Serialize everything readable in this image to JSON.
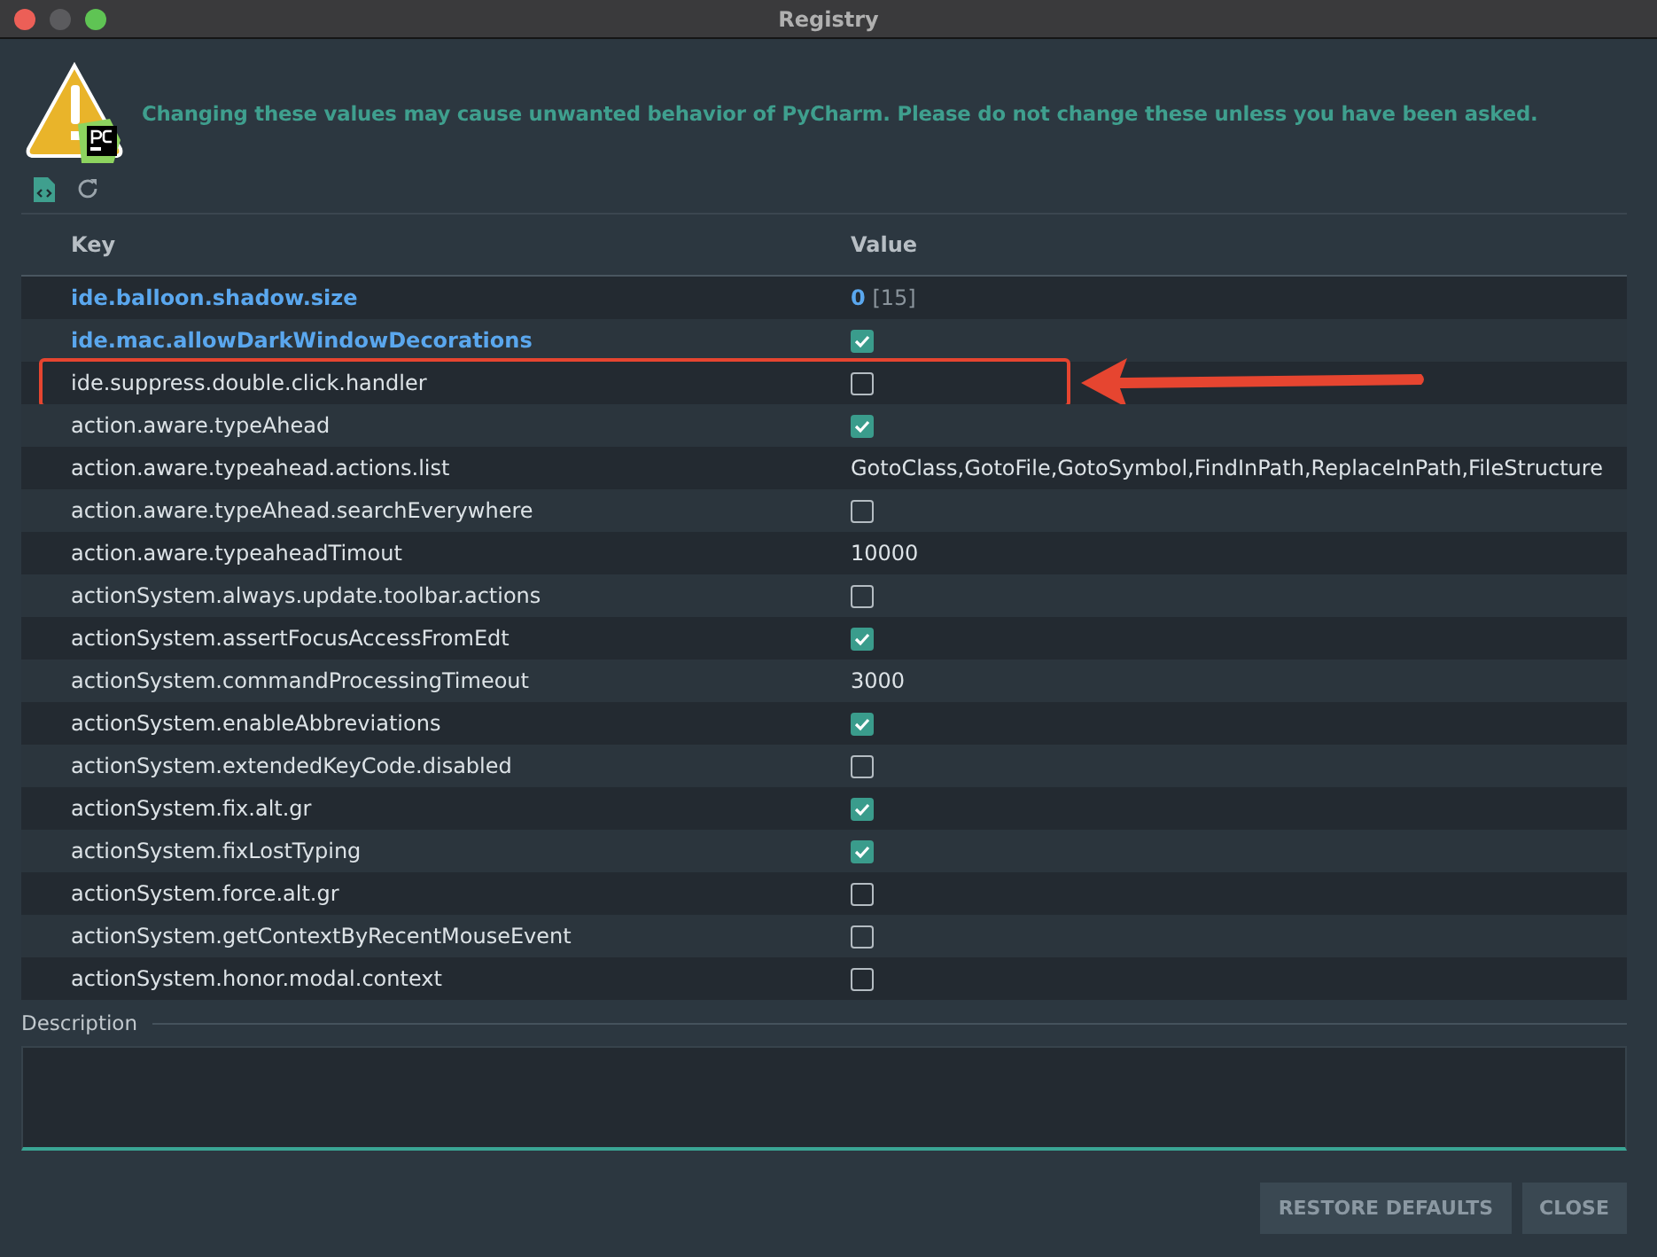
{
  "window": {
    "title": "Registry"
  },
  "warning": "Changing these values may cause unwanted behavior of PyCharm. Please do not change these unless you have been asked.",
  "table": {
    "columns": [
      "Key",
      "Value"
    ],
    "rows": [
      {
        "key": "ide.balloon.shadow.size",
        "kind": "text",
        "value": "0",
        "default": "[15]",
        "modified": true,
        "annotated": false
      },
      {
        "key": "ide.mac.allowDarkWindowDecorations",
        "kind": "checkbox",
        "checked": true,
        "modified": true,
        "annotated": false
      },
      {
        "key": "ide.suppress.double.click.handler",
        "kind": "checkbox",
        "checked": false,
        "modified": false,
        "annotated": true
      },
      {
        "key": "action.aware.typeAhead",
        "kind": "checkbox",
        "checked": true,
        "modified": false,
        "annotated": false
      },
      {
        "key": "action.aware.typeahead.actions.list",
        "kind": "text",
        "value": "GotoClass,GotoFile,GotoSymbol,FindInPath,ReplaceInPath,FileStructure",
        "modified": false,
        "annotated": false
      },
      {
        "key": "action.aware.typeAhead.searchEverywhere",
        "kind": "checkbox",
        "checked": false,
        "modified": false,
        "annotated": false
      },
      {
        "key": "action.aware.typeaheadTimout",
        "kind": "text",
        "value": "10000",
        "modified": false,
        "annotated": false
      },
      {
        "key": "actionSystem.always.update.toolbar.actions",
        "kind": "checkbox",
        "checked": false,
        "modified": false,
        "annotated": false
      },
      {
        "key": "actionSystem.assertFocusAccessFromEdt",
        "kind": "checkbox",
        "checked": true,
        "modified": false,
        "annotated": false
      },
      {
        "key": "actionSystem.commandProcessingTimeout",
        "kind": "text",
        "value": "3000",
        "modified": false,
        "annotated": false
      },
      {
        "key": "actionSystem.enableAbbreviations",
        "kind": "checkbox",
        "checked": true,
        "modified": false,
        "annotated": false
      },
      {
        "key": "actionSystem.extendedKeyCode.disabled",
        "kind": "checkbox",
        "checked": false,
        "modified": false,
        "annotated": false
      },
      {
        "key": "actionSystem.fix.alt.gr",
        "kind": "checkbox",
        "checked": true,
        "modified": false,
        "annotated": false
      },
      {
        "key": "actionSystem.fixLostTyping",
        "kind": "checkbox",
        "checked": true,
        "modified": false,
        "annotated": false
      },
      {
        "key": "actionSystem.force.alt.gr",
        "kind": "checkbox",
        "checked": false,
        "modified": false,
        "annotated": false
      },
      {
        "key": "actionSystem.getContextByRecentMouseEvent",
        "kind": "checkbox",
        "checked": false,
        "modified": false,
        "annotated": false
      },
      {
        "key": "actionSystem.honor.modal.context",
        "kind": "checkbox",
        "checked": false,
        "modified": false,
        "annotated": false
      }
    ]
  },
  "description": {
    "label": "Description"
  },
  "buttons": [
    "RESTORE DEFAULTS",
    "CLOSE"
  ]
}
